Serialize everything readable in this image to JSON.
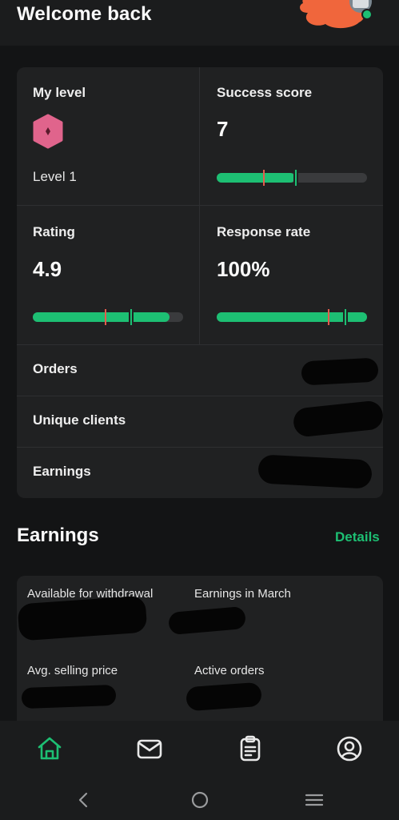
{
  "header": {
    "title": "Welcome back"
  },
  "stats": {
    "my_level": {
      "label": "My level",
      "level_text": "Level 1"
    },
    "success_score": {
      "label": "Success score",
      "value": "7",
      "bar_fill": 0.52,
      "marks": [
        0.31,
        0.52
      ]
    },
    "rating": {
      "label": "Rating",
      "value": "4.9",
      "bar_fill": 0.91,
      "marks": [
        0.48,
        0.65
      ]
    },
    "response_rate": {
      "label": "Response rate",
      "value": "100%",
      "bar_fill": 1.0,
      "marks": [
        0.74,
        0.85
      ]
    }
  },
  "rows": [
    {
      "label": "Orders"
    },
    {
      "label": "Unique clients"
    },
    {
      "label": "Earnings"
    }
  ],
  "earnings": {
    "title": "Earnings",
    "details_label": "Details",
    "cells": [
      {
        "label": "Available for withdrawal"
      },
      {
        "label": "Earnings in March"
      },
      {
        "label": "Avg. selling price"
      },
      {
        "label": "Active orders"
      }
    ]
  },
  "nav": {
    "items": [
      "home-icon",
      "inbox-icon",
      "orders-icon",
      "profile-icon"
    ],
    "active_color": "#1dbf73",
    "inactive_color": "#e8e8e8"
  },
  "system_nav": [
    "back-icon",
    "home-circle-icon",
    "recents-icon"
  ],
  "colors": {
    "accent": "#1dbf73",
    "warning_mark": "#e45b4c",
    "badge": "#e0648c"
  }
}
